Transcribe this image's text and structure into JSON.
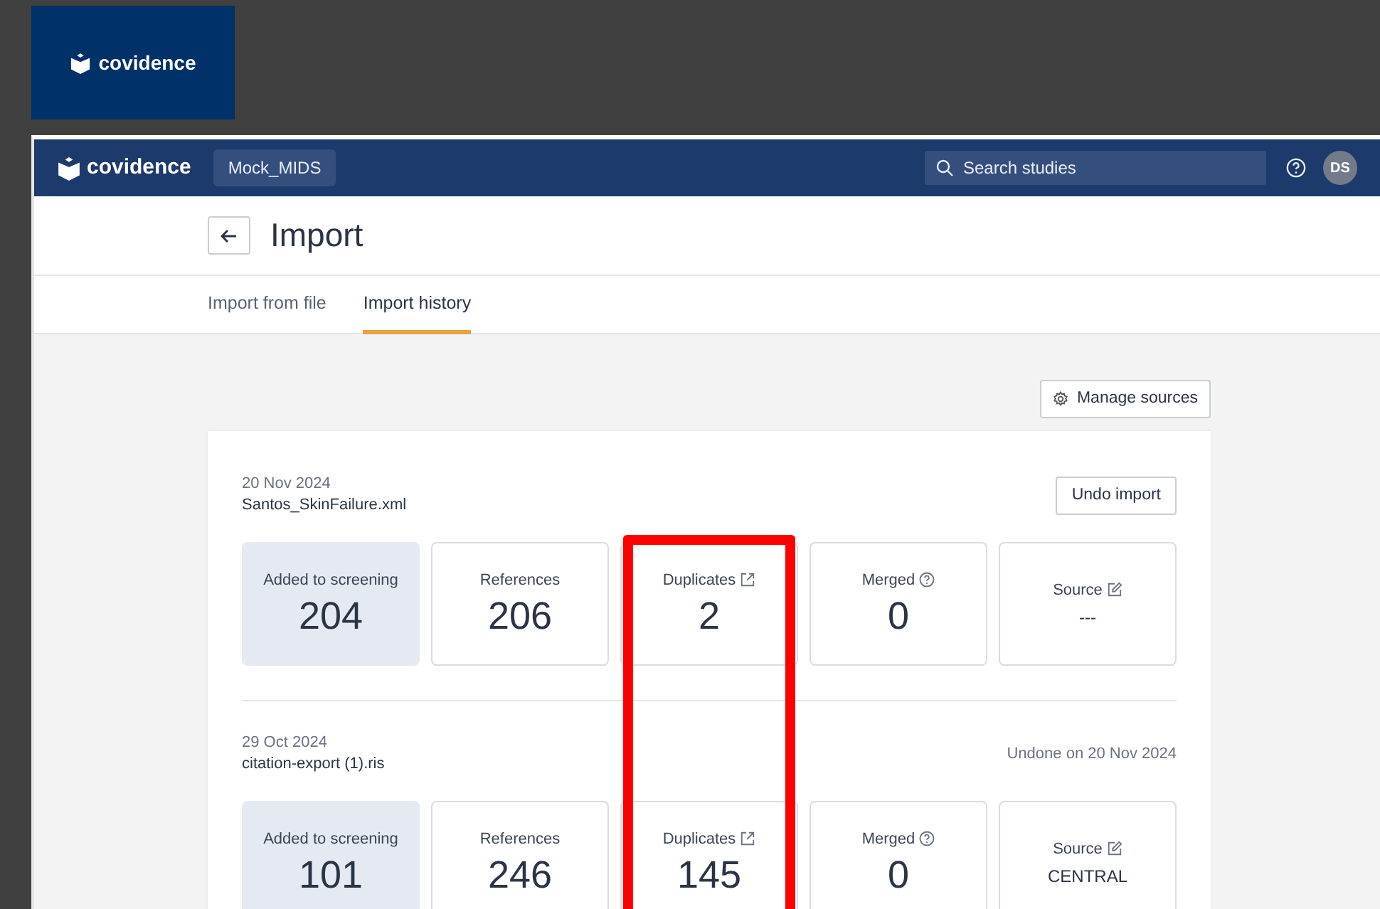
{
  "outer_logo": {
    "text": "covidence"
  },
  "navbar": {
    "logo": "covidence",
    "project": "Mock_MIDS",
    "search": {
      "placeholder": "Search studies"
    },
    "avatar": "DS"
  },
  "page": {
    "title": "Import"
  },
  "tabs": [
    {
      "label": "Import from file",
      "selected": false
    },
    {
      "label": "Import history",
      "selected": true
    }
  ],
  "manage_button": "Manage sources",
  "imports": [
    {
      "date": "20 Nov 2024",
      "file": "Santos_SkinFailure.xml",
      "action": {
        "kind": "button",
        "text": "Undo import"
      },
      "stats": [
        {
          "label": "Added to screening",
          "value": "204",
          "kind": "highlight",
          "annotated": false
        },
        {
          "label": "References",
          "value": "206",
          "kind": "plain",
          "annotated": false
        },
        {
          "label": "Duplicates",
          "value": "2",
          "kind": "link",
          "annotated": true
        },
        {
          "label": "Merged",
          "value": "0",
          "kind": "help",
          "annotated": false
        },
        {
          "label": "Source",
          "value": "---",
          "kind": "source",
          "annotated": false
        }
      ]
    },
    {
      "date": "29 Oct 2024",
      "file": "citation-export (1).ris",
      "action": {
        "kind": "note",
        "text": "Undone on 20 Nov 2024"
      },
      "stats": [
        {
          "label": "Added to screening",
          "value": "101",
          "kind": "highlight",
          "annotated": false
        },
        {
          "label": "References",
          "value": "246",
          "kind": "plain",
          "annotated": false
        },
        {
          "label": "Duplicates",
          "value": "145",
          "kind": "link",
          "annotated": true
        },
        {
          "label": "Merged",
          "value": "0",
          "kind": "help",
          "annotated": false
        },
        {
          "label": "Source",
          "value": "CENTRAL",
          "kind": "source",
          "annotated": false
        }
      ]
    }
  ]
}
